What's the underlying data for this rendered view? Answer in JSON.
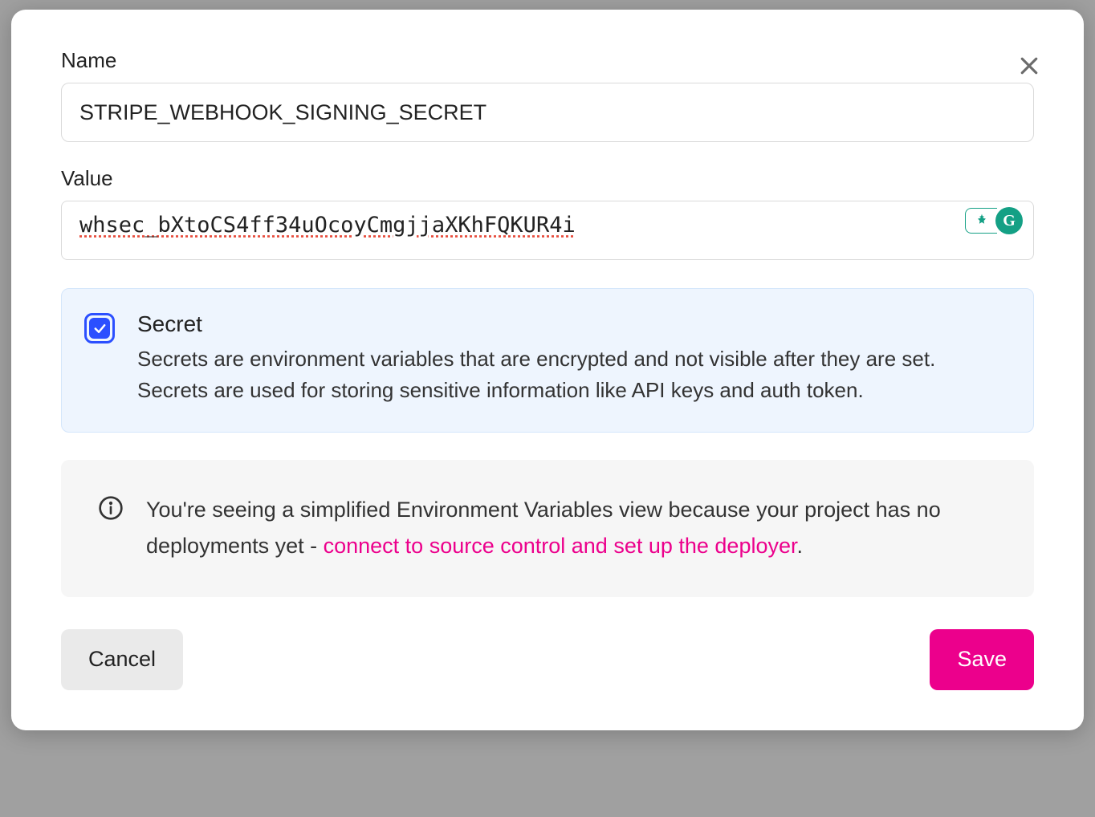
{
  "modal": {
    "name_label": "Name",
    "name_value": "STRIPE_WEBHOOK_SIGNING_SECRET",
    "value_label": "Value",
    "value_value": "whsec_bXtoCS4ff34uOcoyCmgjjaXKhFQKUR4i",
    "secret": {
      "checked": true,
      "title": "Secret",
      "description": "Secrets are environment variables that are encrypted and not visible after they are set. Secrets are used for storing sensitive information like API keys and auth token."
    },
    "info": {
      "text_before": "You're seeing a simplified Environment Variables view because your project has no deployments yet - ",
      "link_text": "connect to source control and set up the deployer",
      "text_after": "."
    },
    "buttons": {
      "cancel": "Cancel",
      "save": "Save"
    },
    "grammarly_letter": "G"
  }
}
